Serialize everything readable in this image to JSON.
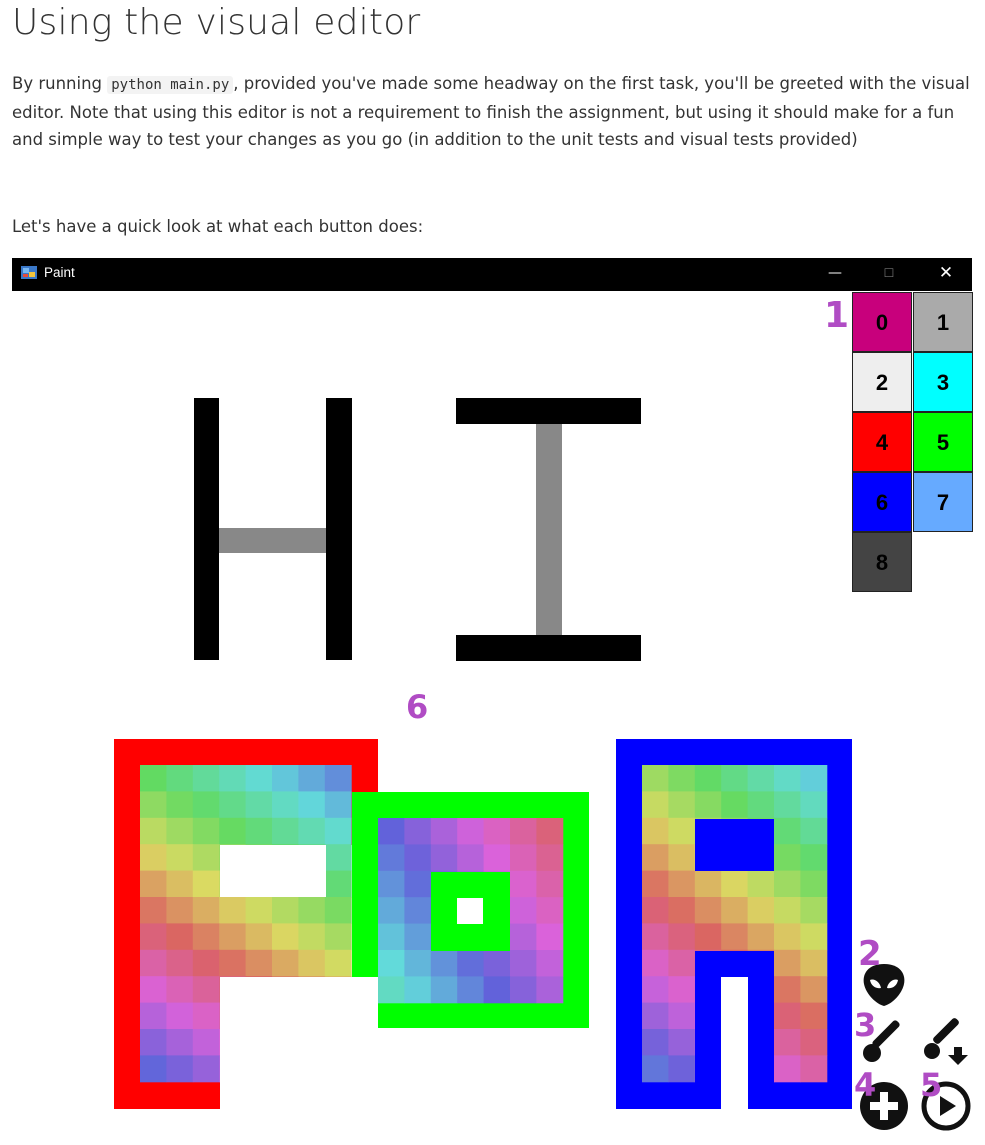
{
  "doc": {
    "heading": "Using the visual editor",
    "para1_a": "By running ",
    "para1_code": "python main.py",
    "para1_b": ", provided you've made some headway on the first task, you'll be greeted with the visual editor. Note that using this editor is not a requirement to finish the assignment, but using it should make for a fun and simple way to test your changes as you go (in addition to the unit tests and visual tests provided)",
    "para2": "Let's have a quick look at what each button does:"
  },
  "window": {
    "title": "Paint",
    "minimize": "—",
    "maximize": "☐",
    "close": "✕"
  },
  "palette": [
    {
      "label": "0",
      "color": "#c8007c"
    },
    {
      "label": "1",
      "color": "#aaaaaa"
    },
    {
      "label": "2",
      "color": "#eeeeee"
    },
    {
      "label": "3",
      "color": "#00ffff"
    },
    {
      "label": "4",
      "color": "#ff0000"
    },
    {
      "label": "5",
      "color": "#00ff00"
    },
    {
      "label": "6",
      "color": "#0000ff"
    },
    {
      "label": "7",
      "color": "#66aaff"
    },
    {
      "label": "8",
      "color": "#444444"
    }
  ],
  "callouts": {
    "palette": "1",
    "alien": "2",
    "brush": "3",
    "add": "4",
    "play": "5",
    "canvas": "6"
  },
  "tools": {
    "alien": "alien-icon",
    "brush": "brush-icon",
    "brush_down": "brush-down-icon",
    "add": "add-icon",
    "play": "play-icon"
  }
}
